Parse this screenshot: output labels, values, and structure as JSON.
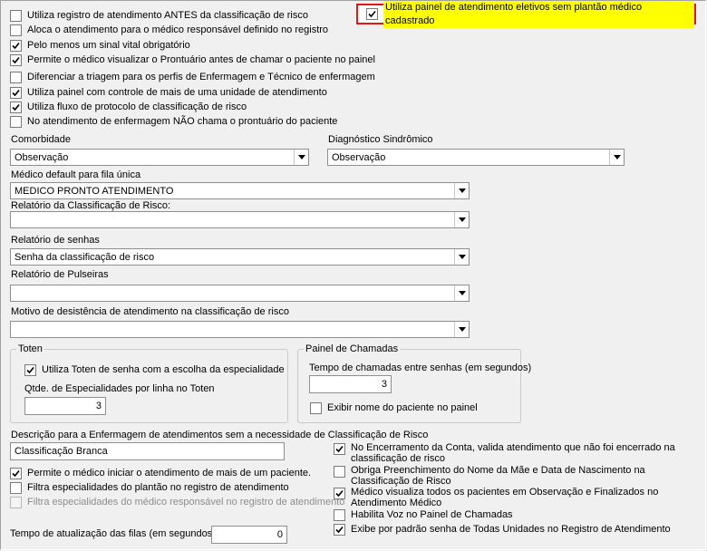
{
  "checkboxes_top": [
    {
      "label": "Utiliza registro de atendimento ANTES da classificação de risco",
      "checked": false
    },
    {
      "label": "Aloca o atendimento para o médico responsável definido no registro",
      "checked": false
    },
    {
      "label": "Pelo menos um sinal vital obrigatório",
      "checked": true
    },
    {
      "label": "Permite o médico visualizar o Prontuário antes de chamar o paciente no painel",
      "checked": true
    },
    {
      "label": "Diferenciar a triagem para os perfis de Enfermagem e Técnico de enfermagem",
      "checked": false
    },
    {
      "label": "Utiliza painel com controle de mais de uma unidade de atendimento",
      "checked": true
    },
    {
      "label": "Utiliza fluxo de protocolo de classificação de risco",
      "checked": true
    },
    {
      "label": "No atendimento de enfermagem NÃO chama o prontuário do paciente",
      "checked": false
    }
  ],
  "highlight_checkbox": {
    "label": "Utiliza painel de atendimento eletivos sem plantão médico cadastrado",
    "checked": true,
    "border_color": "#e01818",
    "label_bg": "#ffff00"
  },
  "comorbidade": {
    "label": "Comorbidade",
    "value": "Observação"
  },
  "diagnostico": {
    "label": "Diagnóstico Sindrômico",
    "value": "Observação"
  },
  "medico_default": {
    "label": "Médico default para fila única",
    "value": "MEDICO PRONTO ATENDIMENTO"
  },
  "relatorio_classificacao": {
    "label": "Relatório da Classificação de Risco:",
    "value": ""
  },
  "relatorio_senhas": {
    "label": "Relatório de senhas",
    "value": "Senha da classificação de risco"
  },
  "relatorio_pulseiras": {
    "label": "Relatório de Pulseiras",
    "value": ""
  },
  "motivo_desistencia": {
    "label": "Motivo de desistência de atendimento na classificação de risco",
    "value": ""
  },
  "toten": {
    "title": "Toten",
    "checkbox": {
      "label": "Utiliza Toten de senha com a escolha da especialidade",
      "checked": true
    },
    "qtde_label": "Qtde. de Especialidades por linha no Toten",
    "qtde_value": "3"
  },
  "painel": {
    "title": "Painel de Chamadas",
    "tempo_label": "Tempo de chamadas entre senhas (em segundos)",
    "tempo_value": "3",
    "checkbox": {
      "label": "Exibir nome do paciente no painel",
      "checked": false
    }
  },
  "descricao": {
    "label": "Descrição para a Enfermagem de atendimentos sem a necessidade de Classificação de Risco",
    "value": "Classificação Branca"
  },
  "checkboxes_bottom_left": [
    {
      "label": "Permite o médico iniciar o atendimento de mais de um paciente.",
      "checked": true,
      "disabled": false
    },
    {
      "label": "Filtra especialidades do plantão no registro de atendimento",
      "checked": false,
      "disabled": false
    },
    {
      "label": "Filtra especialidades do médico responsável no registro de atendimento",
      "checked": false,
      "disabled": true
    }
  ],
  "checkboxes_bottom_right": [
    {
      "label": "No Encerramento da Conta, valida atendimento que não foi encerrado na classificação de risco",
      "checked": true
    },
    {
      "label": "Obriga Preenchimento do Nome da Mãe e Data de Nascimento na Classificação de Risco",
      "checked": false
    },
    {
      "label": "Médico visualiza todos os pacientes em Observação e Finalizados no Atendimento Médico",
      "checked": true
    },
    {
      "label": "Habilita Voz no Painel de Chamadas",
      "checked": false
    },
    {
      "label": "Exibe por padrão senha de Todas Unidades no Registro de Atendimento",
      "checked": true
    }
  ],
  "tempo_atualizacao": {
    "label": "Tempo de atualização das filas (em segundos)",
    "value": "0"
  }
}
